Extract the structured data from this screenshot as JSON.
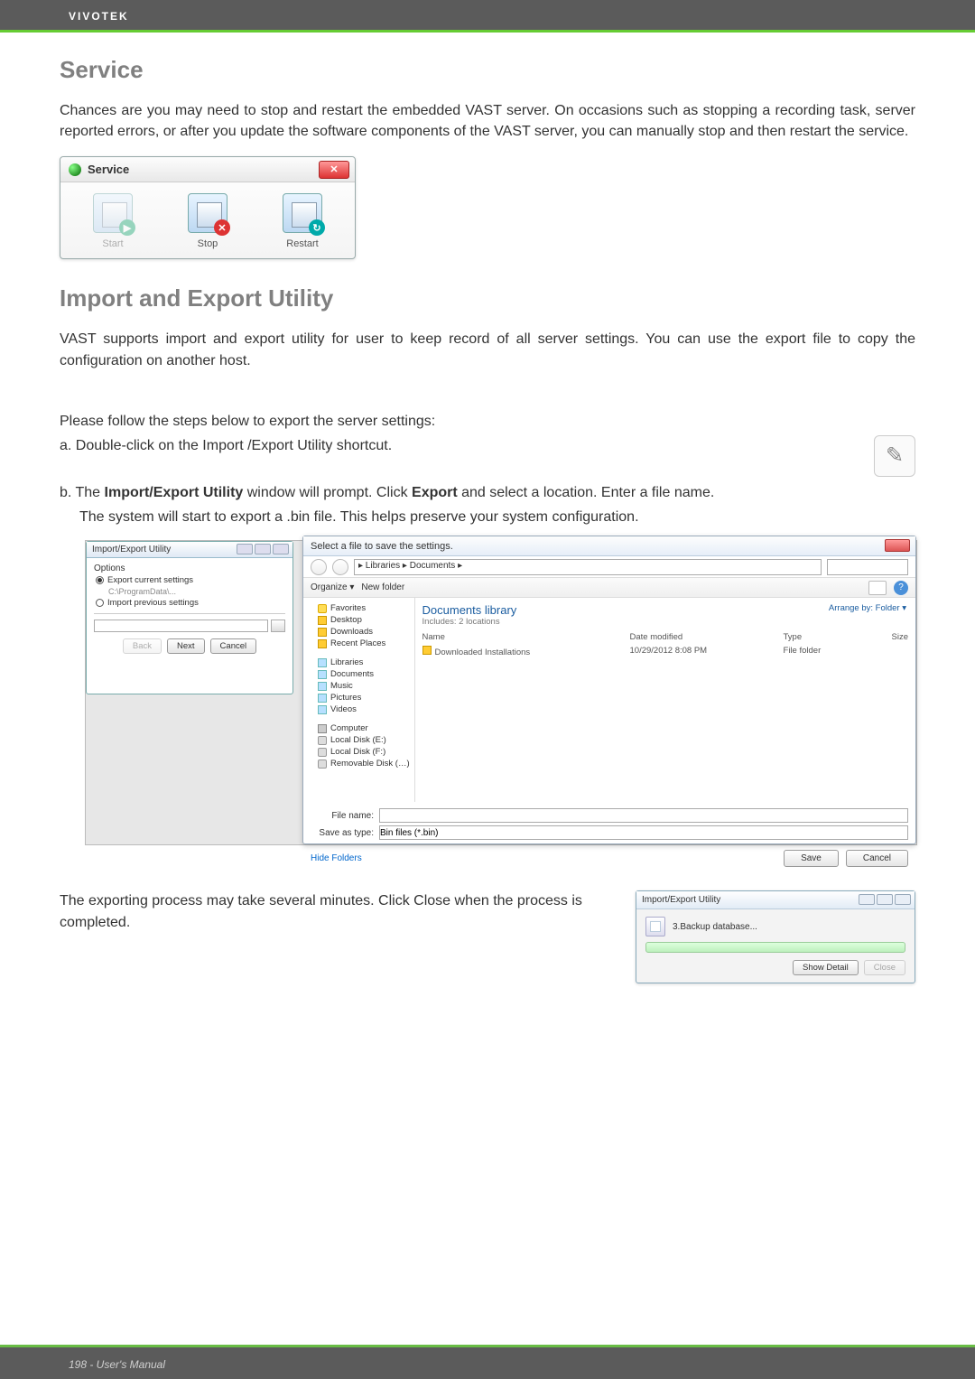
{
  "header": {
    "brand": "VIVOTEK"
  },
  "footer": {
    "text": "198 - User's Manual"
  },
  "sections": {
    "service": {
      "heading": "Service",
      "para": "Chances are you may need to stop and restart the embedded VAST server. On occasions such as stopping a recording task, server reported errors, or after you update the software components of the VAST server, you can manually stop and then restart the service."
    },
    "ieu": {
      "heading": "Import and Export Utility",
      "para": "VAST supports import and export utility for user to keep record of all server settings. You can use the export file to copy the configuration on another host.",
      "steps_intro": "Please follow the steps below to export the server settings:",
      "step_a": "a. Double-click on the Import /Export Utility shortcut.",
      "step_b_pre": "b. The ",
      "step_b_b1": "Import/Export Utility",
      "step_b_mid1": " window will prompt. Click ",
      "step_b_b2": "Export",
      "step_b_mid2": " and select a location. Enter a file name.",
      "step_b_line2": "The system will start to export a .bin file. This helps preserve your system configuration.",
      "export_info": "The exporting process may take several minutes. Click Close when the process is completed."
    }
  },
  "service_panel": {
    "title": "Service",
    "buttons": {
      "start": "Start",
      "stop": "Stop",
      "restart": "Restart"
    }
  },
  "utility_window": {
    "title": "Import/Export Utility",
    "options_label": "Options",
    "opt_export": "Export current settings",
    "opt_export_sub": "C:\\ProgramData\\...",
    "opt_import": "Import previous settings",
    "buttons": {
      "back": "Back",
      "next": "Next",
      "cancel": "Cancel"
    }
  },
  "save_dialog": {
    "title": "Select a file to save the settings.",
    "address": "  ▸ Libraries ▸ Documents ▸",
    "toolbar": {
      "organize": "Organize",
      "newfolder": "New folder"
    },
    "library_title": "Documents library",
    "library_sub": "Includes: 2 locations",
    "arrange": "Arrange by:   Folder ▾",
    "columns": {
      "name": "Name",
      "date": "Date modified",
      "type": "Type",
      "size": "Size"
    },
    "row": {
      "name": "Downloaded Installations",
      "date": "10/29/2012 8:08 PM",
      "type": "File folder",
      "size": ""
    },
    "side": {
      "favorites": "Favorites",
      "desktop": "Desktop",
      "downloads": "Downloads",
      "recent": "Recent Places",
      "libraries": "Libraries",
      "documents": "Documents",
      "music": "Music",
      "pictures": "Pictures",
      "videos": "Videos",
      "computer": "Computer",
      "diskE": "Local Disk (E:)",
      "diskF": "Local Disk (F:)",
      "removable": "Removable Disk (…)"
    },
    "filename_label": "File name:",
    "saveastype_label": "Save as type:",
    "saveastype_value": "Bin files (*.bin)",
    "hide_folders": "Hide Folders",
    "save": "Save",
    "cancel": "Cancel"
  },
  "progress_window": {
    "title": "Import/Export Utility",
    "status": "3.Backup database...",
    "show_detail": "Show Detail",
    "close": "Close"
  }
}
